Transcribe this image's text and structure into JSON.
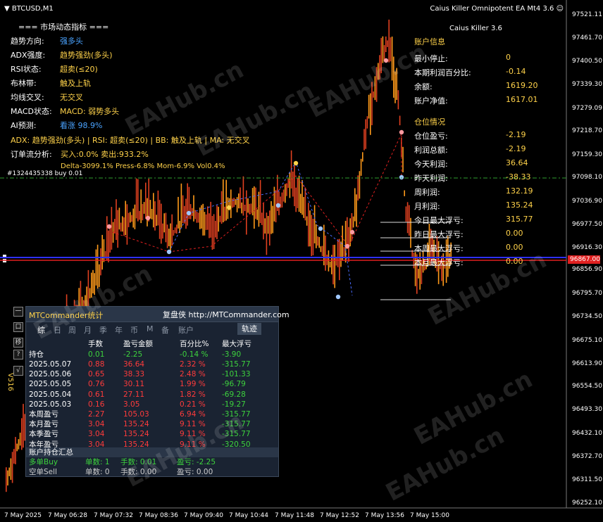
{
  "window": {
    "symbol": "BTCUSD,M1",
    "ea_title": "Caius Killer Omnipotent EA Mt4 3.6",
    "order_tag": "#1324435338 buy 0.01"
  },
  "market_panel": {
    "title": "=== 市场动态指标 ===",
    "rows": [
      {
        "label": "趋势方向:",
        "value": "强多头",
        "color": "#4aa3ff"
      },
      {
        "label": "ADX强度:",
        "value": "趋势强劲(多头)",
        "color": "#ffd24a"
      },
      {
        "label": "RSI状态:",
        "value": "超卖(≤20)",
        "color": "#ffd24a"
      },
      {
        "label": "布林带:",
        "value": "触及上轨",
        "color": "#ffd24a"
      },
      {
        "label": "均线交叉:",
        "value": "无交叉",
        "color": "#ffd24a"
      },
      {
        "label": "MACD状态:",
        "value": "MACD: 弱势多头",
        "color": "#ffd24a"
      },
      {
        "label": "AI预测:",
        "value": "看涨 98.9%",
        "color": "#4aa3ff"
      }
    ],
    "summary_line": "ADX: 趋势强劲(多头) | RSI: 超卖(≤20) | BB: 触及上轨 | MA: 无交叉",
    "orderflow_label": "订单流分析:",
    "orderflow_value": "买入:0.0% 卖出:933.2%",
    "delta_line": "Delta-3099.1% Press-6.8% Mom-6.9% Vol0.4%"
  },
  "account_panel": {
    "version": "Caius Killer 3.6",
    "section_account": "账户信息",
    "rows1": [
      {
        "label": "最小停止:",
        "value": "0"
      },
      {
        "label": "本期利润百分比:",
        "value": "-0.14"
      },
      {
        "label": "余额:",
        "value": "1619.20"
      },
      {
        "label": "账户净值:",
        "value": "1617.01"
      }
    ],
    "section_position": "仓位情况",
    "rows2": [
      {
        "label": "仓位盈亏:",
        "value": "-2.19"
      },
      {
        "label": "利润总额:",
        "value": "-2.19"
      },
      {
        "label": "今天利润:",
        "value": "36.64"
      },
      {
        "label": "昨天利润:",
        "value": "-38.33"
      },
      {
        "label": "周利润:",
        "value": "132.19"
      },
      {
        "label": "月利润:",
        "value": "135.24"
      },
      {
        "label": "今日最大浮亏:",
        "value": "315.77"
      },
      {
        "label": "昨日最大浮亏:",
        "value": "0.00"
      },
      {
        "label": "本周最大浮亏:",
        "value": "0.00"
      },
      {
        "label": "本月最大浮亏:",
        "value": "0.00"
      }
    ]
  },
  "price_axis": {
    "labels": [
      "97521.11",
      "97461.70",
      "97400.50",
      "97339.30",
      "97279.09",
      "97218.70",
      "97159.30",
      "97098.10",
      "97036.90",
      "96977.50",
      "96916.30",
      "96867.00",
      "96856.90",
      "96795.70",
      "96734.50",
      "96675.10",
      "96613.90",
      "96554.50",
      "96493.30",
      "96432.10",
      "96372.70",
      "96311.50",
      "96252.10"
    ],
    "bid_label": "96867.00"
  },
  "time_axis": {
    "labels": [
      "7 May 2025",
      "7 May 06:28",
      "7 May 07:32",
      "7 May 08:36",
      "7 May 09:40",
      "7 May 10:44",
      "7 May 11:48",
      "7 May 12:52",
      "7 May 13:56",
      "7 May 15:00"
    ]
  },
  "side_panel": {
    "buttons": [
      "一",
      "口",
      "移",
      "?",
      "√"
    ],
    "vertical_label": "V516"
  },
  "mtcommander": {
    "title": "MTCommander统计",
    "link": "复盘侠 http://MTCommander.com",
    "tabs": [
      "综",
      "日",
      "周",
      "月",
      "季",
      "年",
      "币",
      "M",
      "备",
      "账户"
    ],
    "track_button": "轨迹",
    "headers": [
      "手数",
      "盈亏金额",
      "百分比%",
      "最大浮亏"
    ],
    "position_label": "持仓",
    "position_row": [
      "0.01",
      "-2.25",
      "-0.14 %",
      "-3.90"
    ],
    "rows": [
      {
        "label": "2025.05.07",
        "v": [
          "0.88",
          "36.64",
          "2.32 %",
          "-315.77"
        ]
      },
      {
        "label": "2025.05.06",
        "v": [
          "0.65",
          "38.33",
          "2.48 %",
          "-101.33"
        ]
      },
      {
        "label": "2025.05.05",
        "v": [
          "0.76",
          "30.11",
          "1.99 %",
          "-96.79"
        ]
      },
      {
        "label": "2025.05.04",
        "v": [
          "0.61",
          "27.11",
          "1.82 %",
          "-69.28"
        ]
      },
      {
        "label": "2025.05.03",
        "v": [
          "0.16",
          "3.05",
          "0.21 %",
          "-19.27"
        ]
      },
      {
        "label": "本周盈亏",
        "v": [
          "2.27",
          "105.03",
          "6.94 %",
          "-315.77"
        ]
      },
      {
        "label": "本月盈亏",
        "v": [
          "3.04",
          "135.24",
          "9.11 %",
          "-315.77"
        ]
      },
      {
        "label": "本季盈亏",
        "v": [
          "3.04",
          "135.24",
          "9.11 %",
          "-315.77"
        ]
      },
      {
        "label": "本年盈亏",
        "v": [
          "3.04",
          "135.24",
          "9.11 %",
          "-320.50"
        ]
      }
    ],
    "summary_title": "账户持仓汇总",
    "buy_label": "多单Buy",
    "buy_count": "单数: 1",
    "buy_lots": "手数: 0.01",
    "buy_pl": "盈亏: -2.25",
    "sell_label": "空单Sell",
    "sell_count": "单数: 0",
    "sell_lots": "手数: 0.00",
    "sell_pl": "盈亏: 0.00"
  },
  "watermark": "EAHub.cn"
}
